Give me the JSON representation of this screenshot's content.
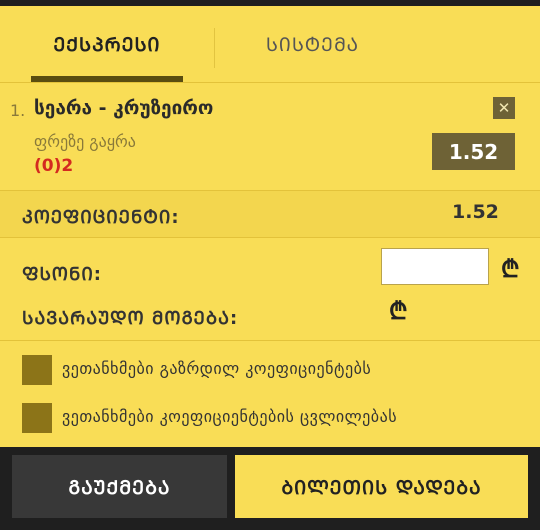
{
  "tabs": [
    {
      "label": "ᲔᲥᲡᲞᲠᲔᲡᲘ",
      "active": true
    },
    {
      "label": "ᲡᲘᲡᲢᲔᲛᲐ",
      "active": false
    }
  ],
  "bet": {
    "number": "1.",
    "match": "სეარა - კრუზეირო",
    "market": "ფრეზე გაყრა",
    "score": "(0)2",
    "odds": "1.52",
    "close_icon": "close-icon"
  },
  "summary": {
    "coef_label": "ᲙᲝᲔᲤᲘᲪᲘᲔᲜᲢᲘ:",
    "coef_value": "1.52",
    "stake_label": "ᲤᲡᲝᲜᲘ:",
    "stake_value": "",
    "currency_symbol": "₾",
    "win_label": "ᲡᲐᲕᲐᲠᲐᲣᲓᲝ ᲛᲝᲒᲔᲑᲐ:"
  },
  "options": [
    {
      "label": "ვეთანხმები გაზრდილ კოეფიციენტებს",
      "checked": false
    },
    {
      "label": "ვეთანხმები კოეფიციენტების ცვლილებას",
      "checked": false
    }
  ],
  "buttons": {
    "cancel": "ᲒᲐᲣᲥᲛᲔᲑᲐ",
    "place": "ᲑᲘᲚᲔᲗᲘᲡ ᲓᲐᲓᲔᲑᲐ"
  },
  "colors": {
    "background": "#f9dd56",
    "odds_box": "#6e6236",
    "score_red": "#d42a1f",
    "checkbox": "#8c7418",
    "footer": "#1f1f1f"
  }
}
